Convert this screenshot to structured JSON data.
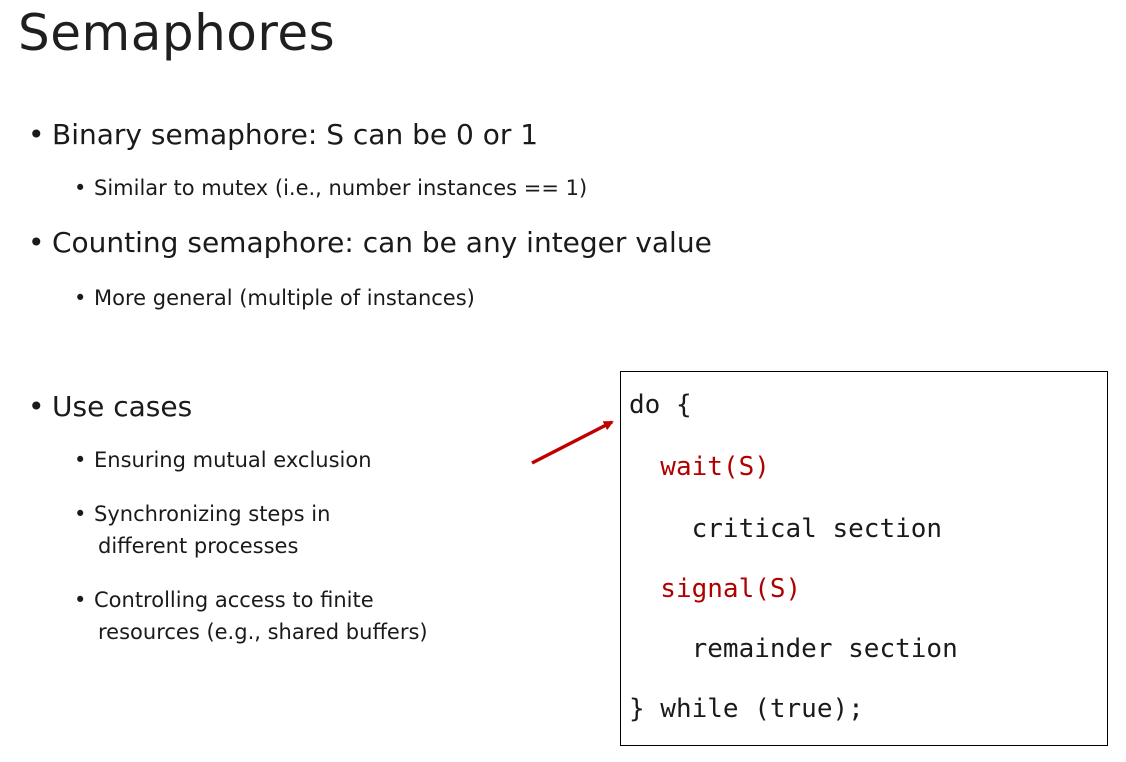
{
  "title": "Semaphores",
  "bullets": {
    "binary": "Binary semaphore: S can be 0 or 1",
    "binary_sub": "Similar to mutex (i.e., number instances == 1)",
    "counting": "Counting semaphore:  can be any integer value",
    "counting_sub": "More general (multiple of instances)",
    "use_cases": "Use cases",
    "uc1": "Ensuring mutual exclusion",
    "uc2a": "Synchronizing steps in",
    "uc2b": "different processes",
    "uc3a": "Controlling access to finite",
    "uc3b": "resources (e.g., shared buffers)"
  },
  "bullet_glyph": "•",
  "code": {
    "line1": "do {",
    "line2": "  wait(S)",
    "line3": "    critical section",
    "line4": "  signal(S)",
    "line5": "    remainder section",
    "line6": "} while (true);"
  },
  "colors": {
    "highlight": "#b00000",
    "arrow": "#c00000"
  }
}
